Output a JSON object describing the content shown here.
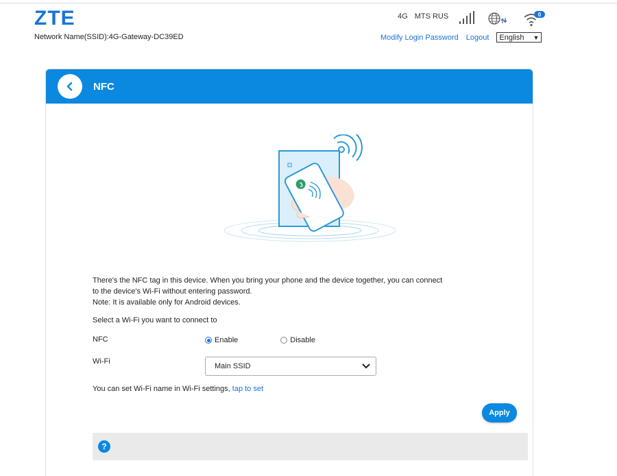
{
  "header": {
    "logo": "ZTE",
    "ssid": "Network Name(SSID):4G-Gateway-DC39ED",
    "network_type": "4G",
    "operator": "MTS RUS",
    "wifi_badge": "0",
    "modify_password": "Modify Login Password",
    "logout": "Logout",
    "language": "English",
    "icons": [
      "signal-bars-icon",
      "globe-data-icon",
      "wifi-icon"
    ]
  },
  "panel": {
    "title": "NFC",
    "accent_color": "#0b88df",
    "description_lines": [
      "There's the NFC tag in this device. When you bring your phone and the device together, you can connect",
      "to the device's Wi-Fi without entering password.",
      "Note: It is available only for Android devices."
    ],
    "select_label": "Select a Wi-Fi you want to connect to",
    "nfc_label": "NFC",
    "nfc_options": {
      "enable": "Enable",
      "disable": "Disable",
      "selected": "Enable"
    },
    "wifi_label": "Wi-Fi",
    "wifi_selected": "Main SSID",
    "hint_text": "You can set Wi-Fi name in Wi-Fi settings,",
    "hint_link": "tap to set",
    "apply": "Apply",
    "help": "?"
  }
}
